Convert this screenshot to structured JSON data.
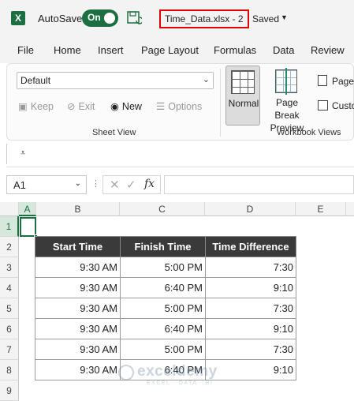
{
  "titlebar": {
    "app_icon": "excel-icon",
    "autosave_label": "AutoSave",
    "autosave_state": "On",
    "filename": "Time_Data.xlsx  -  2",
    "saved_label": "Saved"
  },
  "menu": [
    "File",
    "Home",
    "Insert",
    "Page Layout",
    "Formulas",
    "Data",
    "Review"
  ],
  "ribbon": {
    "sheet_view": {
      "selected_view": "Default",
      "keep": "Keep",
      "exit": "Exit",
      "new": "New",
      "options": "Options",
      "group_label": "Sheet View"
    },
    "workbook_views": {
      "normal": "Normal",
      "page_break_line1": "Page Break",
      "page_break_line2": "Preview",
      "page": "Page",
      "custom": "Custo",
      "group_label": "Workbook Views"
    }
  },
  "formula_bar": {
    "name_box": "A1",
    "fx": "fx",
    "content": ""
  },
  "grid": {
    "columns": [
      "A",
      "B",
      "C",
      "D",
      "E"
    ],
    "rows": [
      "1",
      "2",
      "3",
      "4",
      "5",
      "6",
      "7",
      "8",
      "9"
    ],
    "selected_cell": "A1"
  },
  "table": {
    "headers": [
      "Start Time",
      "Finish Time",
      "Time Difference"
    ],
    "rows": [
      [
        "9:30 AM",
        "5:00 PM",
        "7:30"
      ],
      [
        "9:30 AM",
        "6:40 PM",
        "9:10"
      ],
      [
        "9:30 AM",
        "5:00 PM",
        "7:30"
      ],
      [
        "9:30 AM",
        "6:40 PM",
        "9:10"
      ],
      [
        "9:30 AM",
        "5:00 PM",
        "7:30"
      ],
      [
        "9:30 AM",
        "6:40 PM",
        "9:10"
      ]
    ]
  },
  "watermark": {
    "name": "exceldemy",
    "tagline": "EXCEL · DATA · BI"
  },
  "colors": {
    "excel_green": "#1d6f42",
    "header_fill": "#3a3a3a",
    "highlight_box": "#e00000"
  }
}
